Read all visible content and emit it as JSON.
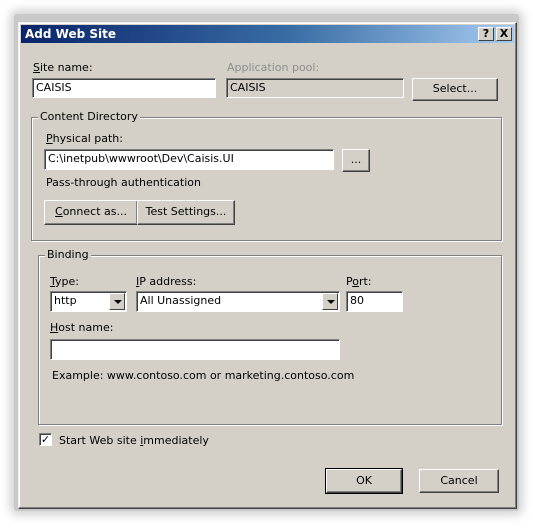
{
  "window": {
    "title": "Add Web Site",
    "help_label": "?",
    "close_label": "X"
  },
  "site": {
    "site_name_label": "Site name:",
    "site_name_value": "CAISIS",
    "app_pool_label": "Application pool:",
    "app_pool_value": "CAISIS",
    "select_button": "Select..."
  },
  "content": {
    "legend": "Content Directory",
    "physical_path_label": "Physical path:",
    "physical_path_value": "C:\\inetpub\\wwwroot\\Dev\\Caisis.UI",
    "browse_button": "...",
    "auth_text": "Pass-through authentication",
    "connect_as_button": "Connect as...",
    "test_settings_button": "Test Settings..."
  },
  "binding": {
    "legend": "Binding",
    "type_label": "Type:",
    "type_value": "http",
    "ip_label": "IP address:",
    "ip_value": "All Unassigned",
    "port_label": "Port:",
    "port_value": "80",
    "host_label": "Host name:",
    "host_value": "",
    "example_text": "Example: www.contoso.com or marketing.contoso.com"
  },
  "start": {
    "checked_glyph": "✓",
    "label": "Start Web site immediately"
  },
  "footer": {
    "ok_button": "OK",
    "cancel_button": "Cancel"
  }
}
